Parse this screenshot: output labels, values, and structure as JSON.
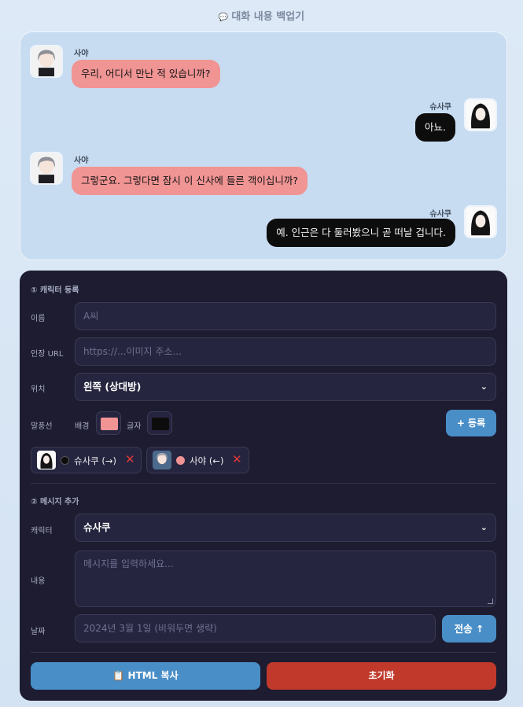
{
  "app": {
    "title_icon": "speech-bubble-icon",
    "title": "대화 내용 백업기"
  },
  "chat": {
    "messages": [
      {
        "speaker": "사야",
        "side": "left",
        "text": "우리, 어디서 만난 적 있습니까?"
      },
      {
        "speaker": "슈사쿠",
        "side": "right",
        "text": "아뇨."
      },
      {
        "speaker": "사야",
        "side": "left",
        "text": "그렇군요. 그렇다면 잠시 이 신사에 들른 객이십니까?"
      },
      {
        "speaker": "슈사쿠",
        "side": "right",
        "text": "예. 인근은 다 둘러봤으니 곧 떠날 겁니다."
      }
    ]
  },
  "register": {
    "section_title": "① 캐릭터 등록",
    "name_label": "이름",
    "name_placeholder": "A씨",
    "url_label": "인장 URL",
    "url_placeholder": "https://...이미지 주소...",
    "position_label": "위치",
    "position_value": "왼쪽 (상대방)",
    "bubble_label": "말풍선",
    "bg_label": "배경",
    "bg_color": "#f19494",
    "text_label": "글자",
    "text_color": "#0d0d0d",
    "register_button": "+ 등록",
    "characters": [
      {
        "label": "슈사쿠 (→)",
        "color": "#0d0d0d",
        "remove": "✕"
      },
      {
        "label": "사야 (←)",
        "color": "#f19494",
        "remove": "✕"
      }
    ]
  },
  "message": {
    "section_title": "② 메시지 추가",
    "character_label": "캐릭터",
    "character_value": "슈사쿠",
    "content_label": "내용",
    "content_placeholder": "메시지를 입력하세요...",
    "date_label": "날짜",
    "date_placeholder": "2024년 3월 1일 (비워두면 생략)",
    "send_button": "전송 ↑"
  },
  "actions": {
    "copy_icon": "clipboard-icon",
    "copy_button": "HTML 복사",
    "reset_button": "초기화"
  }
}
